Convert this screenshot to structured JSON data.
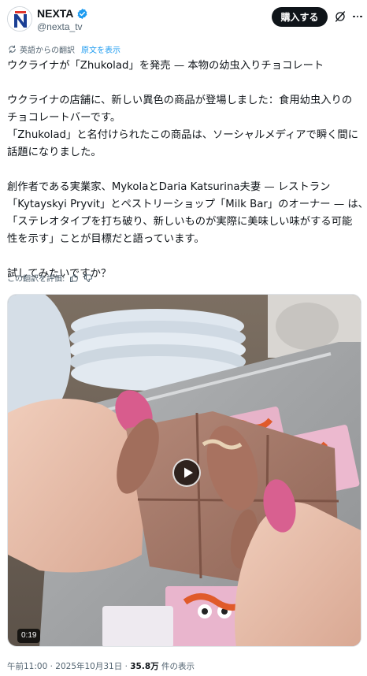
{
  "author": {
    "name": "NEXTA",
    "handle": "@nexta_tv",
    "avatar_icon": "nexta-logo-icon",
    "verified_icon": "verified-badge-icon",
    "verified_color": "#1d9bf0"
  },
  "header": {
    "buy_label": "購入する",
    "grok_icon": "grok-icon",
    "more_icon": "more-dots-icon"
  },
  "translation": {
    "icon": "translate-icon",
    "translated_from": "英語からの翻訳",
    "show_original": "原文を表示"
  },
  "tweet": {
    "lines": [
      "ウクライナが「Zhukolad」を発売 — 本物の幼虫入りチョコレート",
      "",
      "ウクライナの店舗に、新しい異色の商品が登場しました：食用幼虫入りの",
      "チョコレートバーです。",
      "「Zhukolad」と名付けられたこの商品は、ソーシャルメディアで瞬く間に",
      "話題になりました。",
      "",
      "創作者である実業家、MykolaとDaria Katsurina夫妻 — レストラン",
      "「Kytayskyi Pryvit」とペストリーショップ「Milk Bar」のオーナー — は、",
      "「ステレオタイプを打ち破り、新しいものが実際に美味しい味がする可能",
      "性を示す」ことが目標だと語っています。",
      "",
      "試してみたいですか？"
    ]
  },
  "rating": {
    "label": "この翻訳を評価:",
    "thumbs_up_icon": "thumbs-up-icon",
    "thumbs_down_icon": "thumbs-down-icon"
  },
  "media": {
    "type": "video",
    "duration": "0:19",
    "play_icon": "play-icon"
  },
  "meta": {
    "time": "午前11:00",
    "separator": " · ",
    "date": "2025年10月31日",
    "views_count": "35.8万",
    "views_suffix": " 件の表示"
  },
  "colors": {
    "text": "#0f1419",
    "secondary": "#536471",
    "link": "#1d9bf0",
    "button_bg": "#0f1419"
  }
}
